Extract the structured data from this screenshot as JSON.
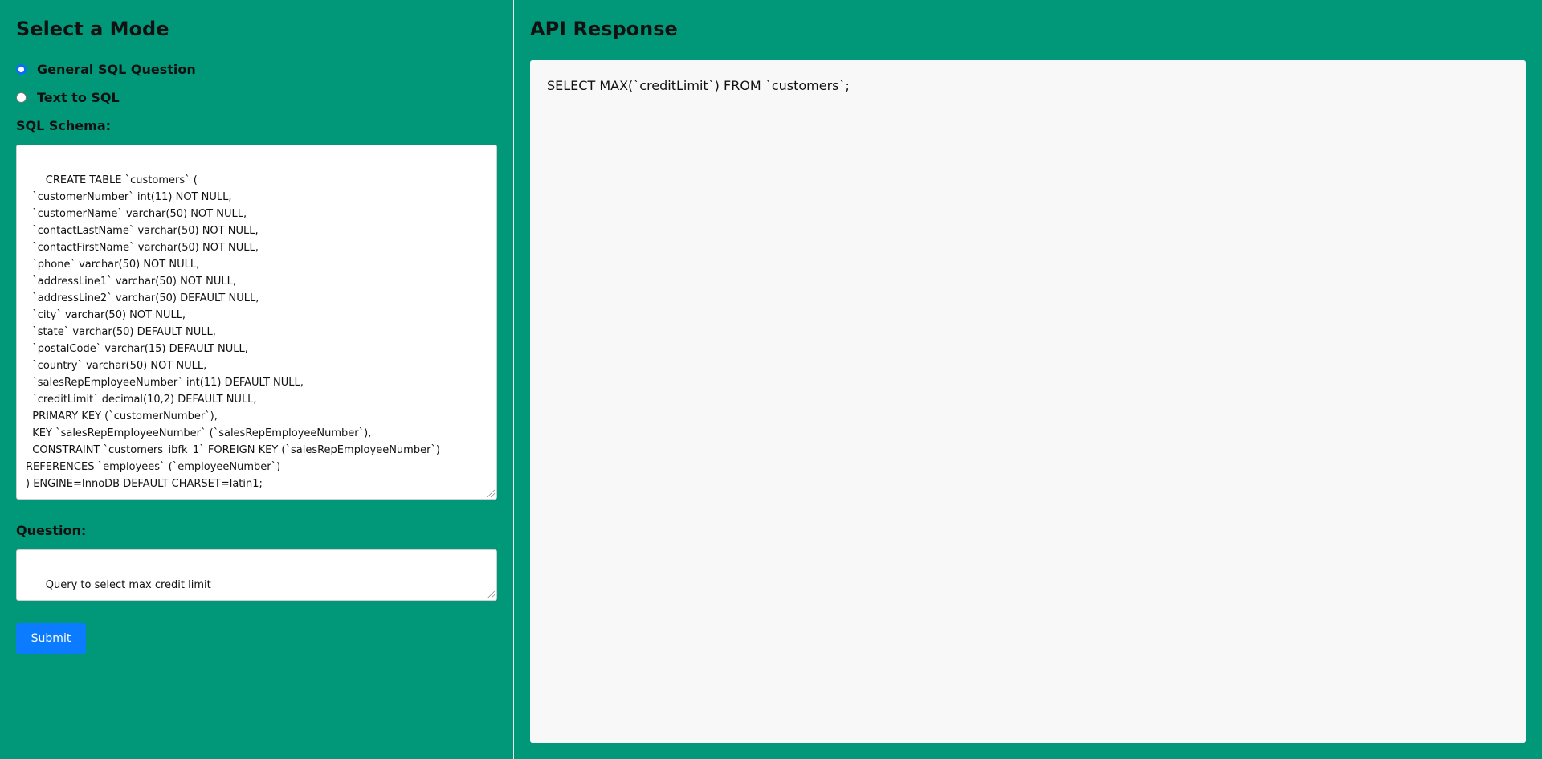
{
  "mode_panel": {
    "title": "Select a Mode",
    "modes": [
      {
        "label": "General SQL Question",
        "selected": true
      },
      {
        "label": "Text to SQL",
        "selected": false
      }
    ],
    "schema_label": "SQL Schema:",
    "schema_value": "CREATE TABLE `customers` (\n  `customerNumber` int(11) NOT NULL,\n  `customerName` varchar(50) NOT NULL,\n  `contactLastName` varchar(50) NOT NULL,\n  `contactFirstName` varchar(50) NOT NULL,\n  `phone` varchar(50) NOT NULL,\n  `addressLine1` varchar(50) NOT NULL,\n  `addressLine2` varchar(50) DEFAULT NULL,\n  `city` varchar(50) NOT NULL,\n  `state` varchar(50) DEFAULT NULL,\n  `postalCode` varchar(15) DEFAULT NULL,\n  `country` varchar(50) NOT NULL,\n  `salesRepEmployeeNumber` int(11) DEFAULT NULL,\n  `creditLimit` decimal(10,2) DEFAULT NULL,\n  PRIMARY KEY (`customerNumber`),\n  KEY `salesRepEmployeeNumber` (`salesRepEmployeeNumber`),\n  CONSTRAINT `customers_ibfk_1` FOREIGN KEY (`salesRepEmployeeNumber`)\nREFERENCES `employees` (`employeeNumber`)\n) ENGINE=InnoDB DEFAULT CHARSET=latin1;",
    "question_label": "Question:",
    "question_value": "Query to select max credit limit",
    "submit_label": "Submit"
  },
  "response_panel": {
    "title": "API Response",
    "response_text": "SELECT MAX(`creditLimit`) FROM `customers`;"
  },
  "colors": {
    "background": "#009879",
    "submit_button": "#0b7bff",
    "response_box": "#f8f8f8"
  }
}
